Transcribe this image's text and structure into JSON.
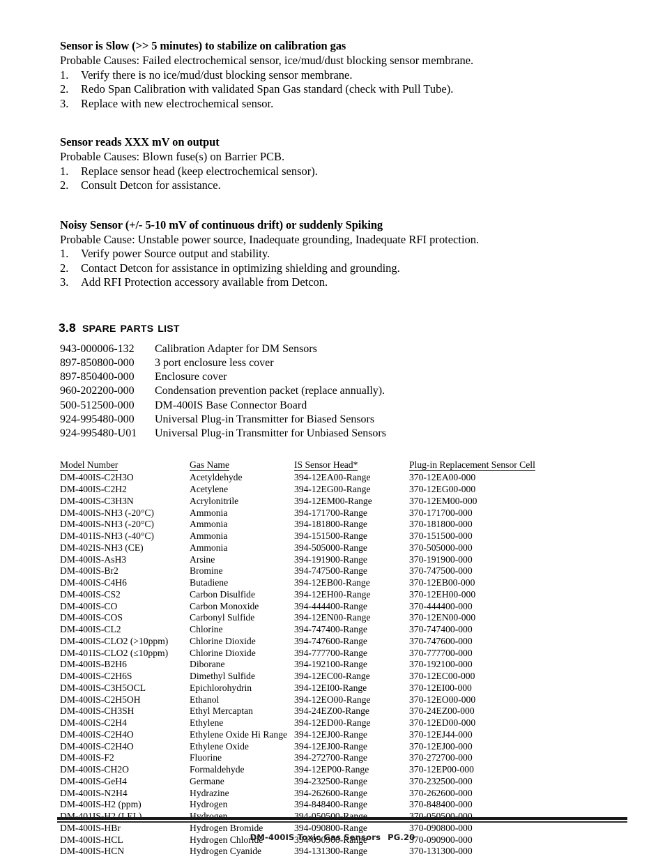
{
  "document": {
    "footer_title": "DM-400IS Toxic Gas Sensors",
    "footer_page": "PG.20"
  },
  "troubleshooting": [
    {
      "heading": "Sensor is Slow (>> 5 minutes) to stabilize on calibration gas",
      "causes": "Probable Causes:  Failed electrochemical sensor,  ice/mud/dust blocking sensor membrane.",
      "steps": [
        {
          "num": "1.",
          "text": "Verify there is no ice/mud/dust blocking sensor membrane."
        },
        {
          "num": "2.",
          "text": "Redo Span Calibration with validated Span Gas standard (check with Pull Tube)."
        },
        {
          "num": "3.",
          "text": "Replace with new electrochemical sensor."
        }
      ]
    },
    {
      "heading": "Sensor reads XXX mV on output",
      "causes": "Probable Causes:  Blown fuse(s) on Barrier PCB.",
      "steps": [
        {
          "num": "1.",
          "text": "Replace sensor head (keep electrochemical sensor)."
        },
        {
          "num": "2.",
          "text": "Consult Detcon for assistance."
        }
      ]
    },
    {
      "heading": "Noisy Sensor (+/- 5-10 mV of continuous drift) or suddenly Spiking",
      "causes": "Probable Cause:  Unstable power source, Inadequate grounding, Inadequate RFI protection.",
      "steps": [
        {
          "num": "1.",
          "text": "Verify power Source output and stability."
        },
        {
          "num": "2.",
          "text": "Contact Detcon for assistance in optimizing shielding and grounding."
        },
        {
          "num": "3.",
          "text": "Add RFI Protection accessory available from Detcon."
        }
      ]
    }
  ],
  "spare_parts_section": {
    "number": "3.8",
    "title": "Spare Parts List",
    "items": [
      {
        "part_number": "943-000006-132",
        "description": "Calibration Adapter for DM Sensors"
      },
      {
        "part_number": "897-850800-000",
        "description": "3 port enclosure less cover"
      },
      {
        "part_number": "897-850400-000",
        "description": "Enclosure cover"
      },
      {
        "part_number": "960-202200-000",
        "description": "Condensation prevention packet (replace annually)."
      },
      {
        "part_number": "500-512500-000",
        "description": "DM-400IS Base Connector Board"
      },
      {
        "part_number": "924-995480-000",
        "description": "Universal Plug-in Transmitter for Biased Sensors"
      },
      {
        "part_number": "924-995480-U01",
        "description": "Universal Plug-in Transmitter for Unbiased Sensors"
      }
    ]
  },
  "model_table": {
    "headers": [
      "Model Number",
      "Gas Name",
      "IS Sensor Head*",
      "Plug-in Replacement Sensor Cell"
    ],
    "rows": [
      [
        "DM-400IS-C2H3O",
        "Acetyldehyde",
        "394-12EA00-Range",
        "370-12EA00-000"
      ],
      [
        "DM-400IS-C2H2",
        "Acetylene",
        "394-12EG00-Range",
        "370-12EG00-000"
      ],
      [
        "DM-400IS-C3H3N",
        "Acrylonitrile",
        "394-12EM00-Range",
        "370-12EM00-000"
      ],
      [
        "DM-400IS-NH3 (-20°C)",
        "Ammonia",
        "394-171700-Range",
        "370-171700-000"
      ],
      [
        "DM-400IS-NH3 (-20°C)",
        "Ammonia",
        "394-181800-Range",
        "370-181800-000"
      ],
      [
        "DM-401IS-NH3 (-40°C)",
        "Ammonia",
        "394-151500-Range",
        "370-151500-000"
      ],
      [
        "DM-402IS-NH3 (CE)",
        "Ammonia",
        "394-505000-Range",
        "370-505000-000"
      ],
      [
        "DM-400IS-AsH3",
        "Arsine",
        "394-191900-Range",
        "370-191900-000"
      ],
      [
        "DM-400IS-Br2",
        "Bromine",
        "394-747500-Range",
        "370-747500-000"
      ],
      [
        "DM-400IS-C4H6",
        "Butadiene",
        "394-12EB00-Range",
        "370-12EB00-000"
      ],
      [
        "DM-400IS-CS2",
        "Carbon Disulfide",
        "394-12EH00-Range",
        "370-12EH00-000"
      ],
      [
        "DM-400IS-CO",
        "Carbon Monoxide",
        "394-444400-Range",
        "370-444400-000"
      ],
      [
        "DM-400IS-COS",
        "Carbonyl Sulfide",
        "394-12EN00-Range",
        "370-12EN00-000"
      ],
      [
        "DM-400IS-CL2",
        "Chlorine",
        "394-747400-Range",
        "370-747400-000"
      ],
      [
        "DM-400IS-CLO2 (>10ppm)",
        "Chlorine Dioxide",
        "394-747600-Range",
        "370-747600-000"
      ],
      [
        "DM-401IS-CLO2 (≤10ppm)",
        "Chlorine Dioxide",
        "394-777700-Range",
        "370-777700-000"
      ],
      [
        "DM-400IS-B2H6",
        "Diborane",
        "394-192100-Range",
        "370-192100-000"
      ],
      [
        "DM-400IS-C2H6S",
        "Dimethyl Sulfide",
        "394-12EC00-Range",
        "370-12EC00-000"
      ],
      [
        "DM-400IS-C3H5OCL",
        "Epichlorohydrin",
        "394-12EI00-Range",
        "370-12EI00-000"
      ],
      [
        "DM-400IS-C2H5OH",
        "Ethanol",
        "394-12EO00-Range",
        "370-12EO00-000"
      ],
      [
        "DM-400IS-CH3SH",
        "Ethyl Mercaptan",
        "394-24EZ00-Range",
        "370-24EZ00-000"
      ],
      [
        "DM-400IS-C2H4",
        "Ethylene",
        "394-12ED00-Range",
        "370-12ED00-000"
      ],
      [
        "DM-400IS-C2H4O",
        "Ethylene Oxide Hi Range",
        "394-12EJ00-Range",
        "370-12EJ44-000"
      ],
      [
        "DM-400IS-C2H4O",
        "Ethylene Oxide",
        "394-12EJ00-Range",
        "370-12EJ00-000"
      ],
      [
        "DM-400IS-F2",
        "Fluorine",
        "394-272700-Range",
        "370-272700-000"
      ],
      [
        "DM-400IS-CH2O",
        "Formaldehyde",
        "394-12EP00-Range",
        "370-12EP00-000"
      ],
      [
        "DM-400IS-GeH4",
        "Germane",
        "394-232500-Range",
        "370-232500-000"
      ],
      [
        "DM-400IS-N2H4",
        "Hydrazine",
        "394-262600-Range",
        "370-262600-000"
      ],
      [
        "DM-400IS-H2 (ppm)",
        "Hydrogen",
        "394-848400-Range",
        "370-848400-000"
      ],
      [
        "DM-401IS-H2 (LEL)",
        "Hydrogen",
        "394-050500-Range",
        "370-050500-000"
      ],
      [
        "DM-400IS-HBr",
        "Hydrogen Bromide",
        "394-090800-Range",
        "370-090800-000"
      ],
      [
        "DM-400IS-HCL",
        "Hydrogen Chloride",
        "394-090900-Range",
        "370-090900-000"
      ],
      [
        "DM-400IS-HCN",
        "Hydrogen Cyanide",
        "394-131300-Range",
        "370-131300-000"
      ]
    ]
  }
}
